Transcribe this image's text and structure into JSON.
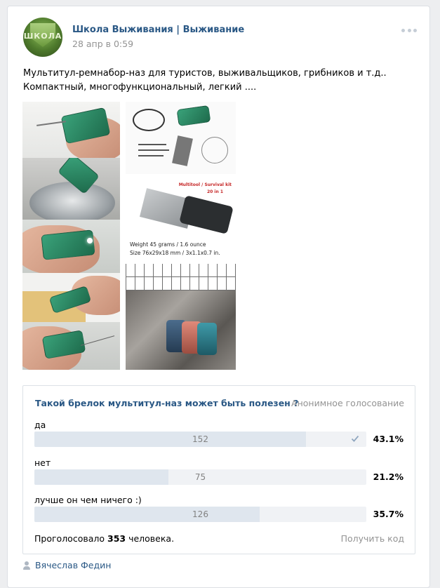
{
  "post": {
    "author": "Школа Выживания | Выживание",
    "date": "28 апр в 0:59",
    "avatar_text": "ШКОЛА",
    "text_lines": [
      "Мультитул-ремнабор-наз для туристов, выживальщиков, грибников и т.д..",
      "Компактный, многофункциональный, легкий ...."
    ]
  },
  "images": {
    "kit_label": "Multitool / Survival kit",
    "kit_sub": "20 in 1",
    "weight": "Weight 45 grams / 1.6 ounce",
    "size": "Size 76x29x18 mm / 3x1.1x0.7 in."
  },
  "poll": {
    "question": "Такой брелок мультитул-наз может быть полезен ?",
    "type": "Анонимное голосование",
    "options": [
      {
        "label": "да",
        "votes": "152",
        "percent": "43.1%",
        "fraction": 0.431,
        "voted": true
      },
      {
        "label": "нет",
        "votes": "75",
        "percent": "21.2%",
        "fraction": 0.212,
        "voted": false
      },
      {
        "label": "лучше он чем ничего :)",
        "votes": "126",
        "percent": "35.7%",
        "fraction": 0.357,
        "voted": false
      }
    ],
    "voted_prefix": "Проголосовало",
    "voted_count": "353",
    "voted_suffix": "человека.",
    "get_code": "Получить код"
  },
  "signer": {
    "name": "Вячеслав Федин"
  },
  "colors": {
    "link": "#2a5885",
    "muted": "#939393",
    "bar_bg": "#f0f2f5",
    "bar_fill": "#dfe6ee"
  },
  "icons": [
    "more-dots-icon",
    "check-icon",
    "user-icon"
  ]
}
